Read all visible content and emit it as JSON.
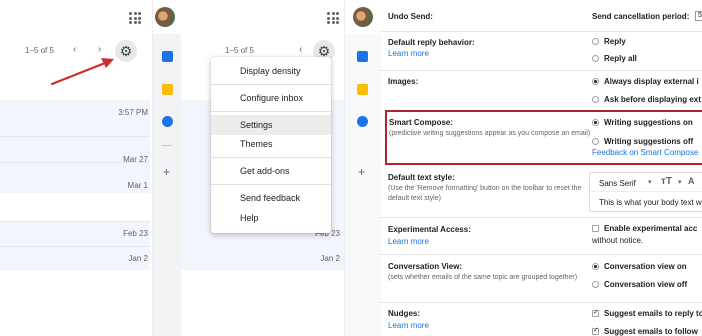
{
  "panel1": {
    "pager": "1–5 of 5",
    "dates": [
      "3:57 PM",
      "Mar 27",
      "Mar 1",
      "Feb 23",
      "Jan 2"
    ]
  },
  "panel2": {
    "pager": "1–5 of 5",
    "dates": [
      "Feb 23",
      "Jan 2"
    ],
    "menu": [
      "Display density",
      "Configure inbox",
      "Settings",
      "Themes",
      "Get add-ons",
      "Send feedback",
      "Help"
    ]
  },
  "settings": {
    "undo_send": {
      "label": "Undo Send:",
      "period_label": "Send cancellation period:",
      "period_value": "5"
    },
    "reply": {
      "label": "Default reply behavior:",
      "link": "Learn more",
      "options": [
        "Reply",
        "Reply all"
      ]
    },
    "images": {
      "label": "Images:",
      "options": [
        "Always display external i",
        "Ask before displaying ext"
      ]
    },
    "smart_compose": {
      "label": "Smart Compose:",
      "desc": "(predictive writing suggestions appear as you compose an email)",
      "options": [
        "Writing suggestions on",
        "Writing suggestions off"
      ],
      "link": "Feedback on Smart Compose"
    },
    "text_style": {
      "label": "Default text style:",
      "desc": "(Use the 'Remove formatting' button on the toolbar to reset the default text style)",
      "font": "Sans Serif",
      "preview": "This is what your body text w"
    },
    "experimental": {
      "label": "Experimental Access:",
      "link": "Learn more",
      "option": "Enable experimental acc",
      "note": "without notice."
    },
    "conversation": {
      "label": "Conversation View:",
      "desc": "(sets whether emails of the same topic are grouped together)",
      "options": [
        "Conversation view on",
        "Conversation view off"
      ]
    },
    "nudges": {
      "label": "Nudges:",
      "link": "Learn more",
      "options": [
        "Suggest emails to reply to",
        "Suggest emails to follow"
      ]
    }
  },
  "colors": {
    "highlight": "#b0262e",
    "link": "#1a73e8",
    "arrow": "#d12b2b"
  },
  "icons": [
    "apps-grid-icon",
    "avatar",
    "chevron-left-icon",
    "chevron-right-icon",
    "gear-icon",
    "calendar-icon",
    "keep-icon",
    "tasks-icon",
    "add-icon"
  ]
}
